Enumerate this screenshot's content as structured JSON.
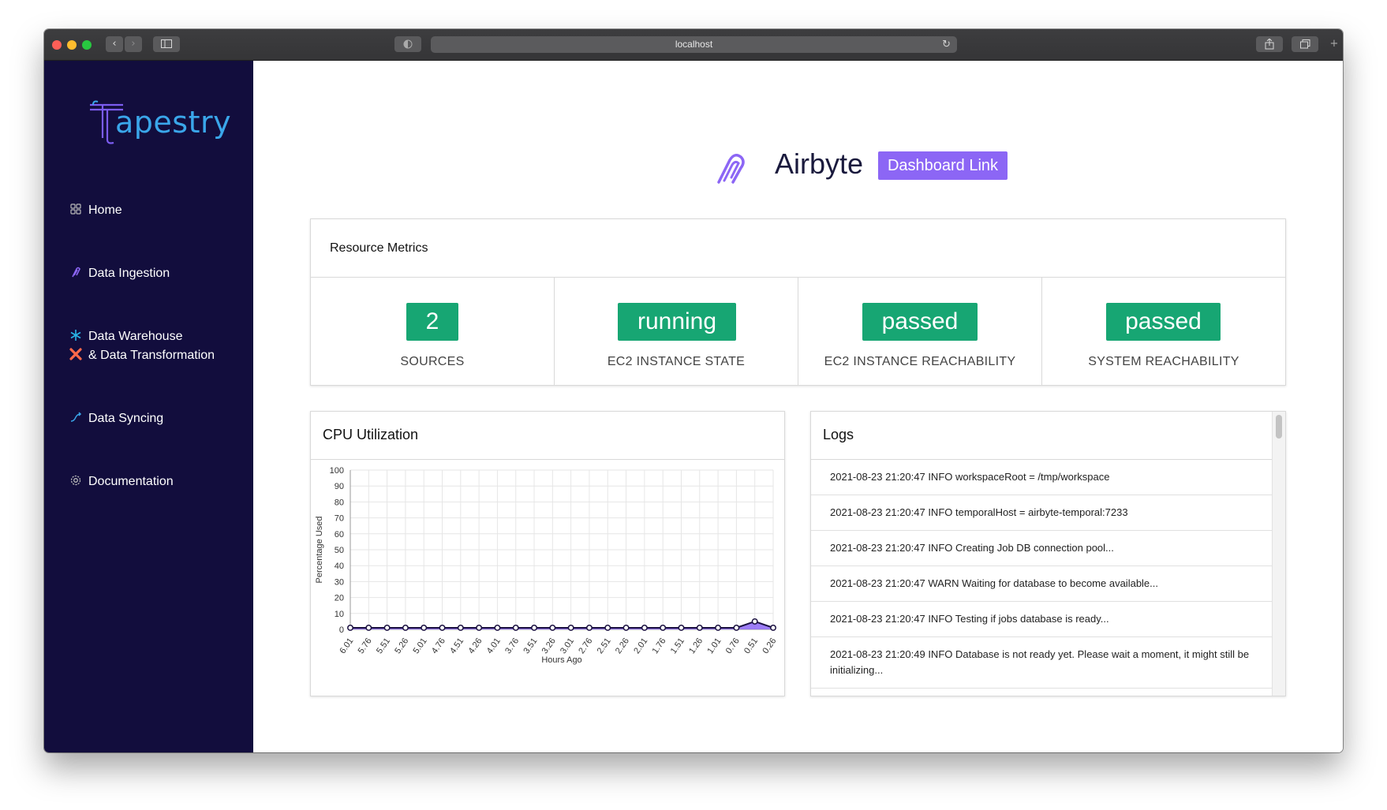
{
  "browser": {
    "url": "localhost",
    "traffic_lights": [
      "#fe5f57",
      "#febc2e",
      "#28c840"
    ]
  },
  "sidebar": {
    "logo_text": "apestry",
    "items": [
      {
        "label": "Home",
        "icon": "grid-icon"
      },
      {
        "label": "Data Ingestion",
        "icon": "airbyte-icon"
      },
      {
        "label_line1": "Data Warehouse",
        "label_line2": "& Data Transformation",
        "icon1": "snowflake-icon",
        "icon2": "dbt-icon"
      },
      {
        "label": "Data Syncing",
        "icon": "sync-icon"
      },
      {
        "label": "Documentation",
        "icon": "gear-icon"
      }
    ]
  },
  "header": {
    "title": "Airbyte",
    "dashboard_link": "Dashboard Link"
  },
  "metrics": {
    "title": "Resource Metrics",
    "items": [
      {
        "value": "2",
        "label": "SOURCES"
      },
      {
        "value": "running",
        "label": "EC2 INSTANCE STATE"
      },
      {
        "value": "passed",
        "label": "EC2 INSTANCE REACHABILITY"
      },
      {
        "value": "passed",
        "label": "SYSTEM REACHABILITY"
      }
    ],
    "badge_color": "#17a673"
  },
  "cpu": {
    "title": "CPU Utilization"
  },
  "chart_data": {
    "type": "area",
    "xlabel": "Hours Ago",
    "ylabel": "Percentage Used",
    "ylim": [
      0,
      100
    ],
    "yticks": [
      0,
      10,
      20,
      30,
      40,
      50,
      60,
      70,
      80,
      90,
      100
    ],
    "categories": [
      "6.01",
      "5.76",
      "5.51",
      "5.26",
      "5.01",
      "4.76",
      "4.51",
      "4.26",
      "4.01",
      "3.76",
      "3.51",
      "3.26",
      "3.01",
      "2.76",
      "2.51",
      "2.26",
      "2.01",
      "1.76",
      "1.51",
      "1.26",
      "1.01",
      "0.76",
      "0.51",
      "0.26"
    ],
    "values": [
      1,
      1,
      1,
      1,
      1,
      1,
      1,
      1,
      1,
      1,
      1,
      1,
      1,
      1,
      1,
      1,
      1,
      1,
      1,
      1,
      1,
      1,
      5,
      1
    ],
    "fill_color": "#8c66f5",
    "grid": true
  },
  "logs": {
    "title": "Logs",
    "entries": [
      "2021-08-23 21:20:47 INFO workspaceRoot = /tmp/workspace",
      "2021-08-23 21:20:47 INFO temporalHost = airbyte-temporal:7233",
      "2021-08-23 21:20:47 INFO Creating Job DB connection pool...",
      "2021-08-23 21:20:47 WARN Waiting for database to become available...",
      "2021-08-23 21:20:47 INFO Testing if jobs database is ready...",
      "2021-08-23 21:20:49 INFO Database is not ready yet. Please wait a moment, it might still be initializing..."
    ]
  }
}
